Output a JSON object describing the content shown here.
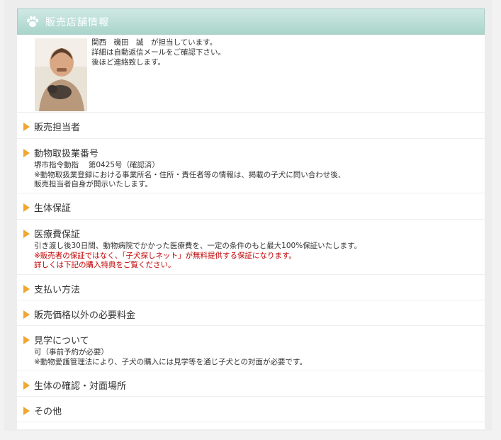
{
  "header": {
    "title": "販売店舗情報",
    "icon": "paw-icon"
  },
  "staff": {
    "lines": [
      "関西　磯田　誠　が担当しています。",
      "詳細は自動返信メールをご確認下さい。",
      "後ほど連絡致します。"
    ]
  },
  "sections": [
    {
      "title": "販売担当者"
    },
    {
      "title": "動物取扱業番号",
      "lines": [
        "堺市指令動指　 第0425号（確認済）",
        "※動物取扱業登録における事業所名・住所・責任者等の情報は、掲載の子犬に問い合わせ後、",
        "販売担当者自身が開示いたします。"
      ]
    },
    {
      "title": "生体保証"
    },
    {
      "title": "医療費保証",
      "lines": [
        "引き渡し後30日間、動物病院でかかった医療費を、一定の条件のもと最大100%保証いたします。"
      ],
      "red_lines": [
        "※販売者の保証ではなく、「子犬探しネット」が無料提供する保証になります。",
        "詳しくは下記の購入特典をご覧ください。"
      ]
    },
    {
      "title": "支払い方法"
    },
    {
      "title": "販売価格以外の必要料金"
    },
    {
      "title": "見学について",
      "lines": [
        "可（事前予約が必要）",
        "※動物愛護管理法により、子犬の購入には見学等を通じ子犬との対面が必要です。"
      ]
    },
    {
      "title": "生体の確認・対面場所"
    },
    {
      "title": "その他"
    }
  ],
  "colors": {
    "header_start": "#cfe9e3",
    "header_end": "#a9d4cb",
    "arrow": "#f0a630",
    "note_red": "#c00000"
  }
}
